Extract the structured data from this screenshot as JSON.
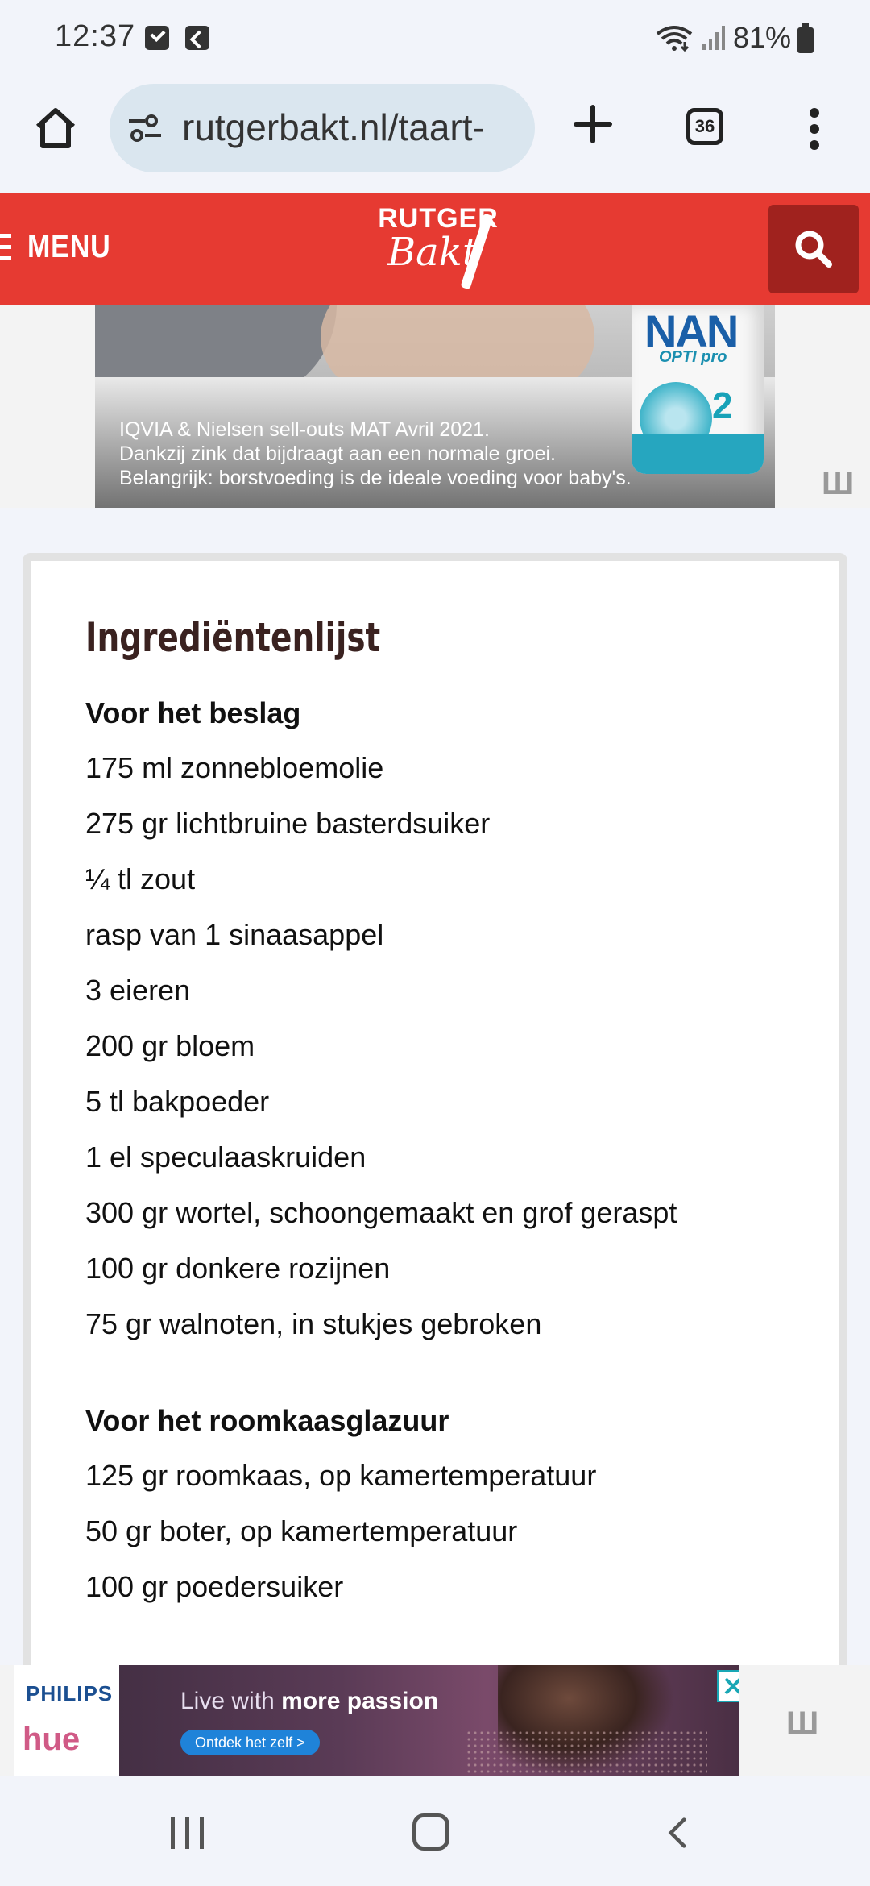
{
  "status_bar": {
    "time": "12:37",
    "battery": "81%"
  },
  "browser": {
    "url": "rutgerbakt.nl/taart-",
    "tab_count": "36"
  },
  "site": {
    "menu_label": "MENU",
    "logo_top": "RUTGER",
    "logo_bottom": "Bakt"
  },
  "ad_top": {
    "brand": "NAN",
    "sub": "OPTI pro",
    "num": "2",
    "lines": [
      "IQVIA & Nielsen sell-outs MAT Avril 2021.",
      "Dankzij zink dat bijdraagt aan een normale groei.",
      "Belangrijk: borstvoeding is de ideale voeding voor baby's."
    ]
  },
  "recipe": {
    "title": "Ingrediëntenlijst",
    "sections": [
      {
        "heading": "Voor het beslag",
        "items": [
          "175 ml zonnebloemolie",
          "275 gr lichtbruine basterdsuiker",
          "¼ tl zout",
          "rasp van 1 sinaasappel",
          "3 eieren",
          "200 gr bloem",
          "5 tl bakpoeder",
          "1 el speculaaskruiden",
          "300 gr wortel, schoongemaakt en grof geraspt",
          "100 gr donkere rozijnen",
          "75 gr walnoten, in stukjes gebroken"
        ]
      },
      {
        "heading": "Voor het roomkaasglazuur",
        "items": [
          "125 gr roomkaas, op kamertemperatuur",
          "50 gr boter, op kamertemperatuur",
          "100 gr poedersuiker"
        ]
      }
    ]
  },
  "ad_bottom": {
    "brand": "PHILIPS",
    "sub_brand": "hue",
    "headline_pre": "Live with ",
    "headline_bold": "more passion",
    "cta": "Ontdek het zelf >"
  },
  "colors": {
    "brand_red": "#e63a32",
    "brand_dark_red": "#a0221e",
    "title_brown": "#3a2220"
  },
  "icons": [
    "home-icon",
    "tune-icon",
    "plus-icon",
    "tabs-icon",
    "more-vert-icon",
    "hamburger-icon",
    "search-icon",
    "close-icon",
    "recent-apps-icon",
    "home-nav-icon",
    "back-icon"
  ]
}
